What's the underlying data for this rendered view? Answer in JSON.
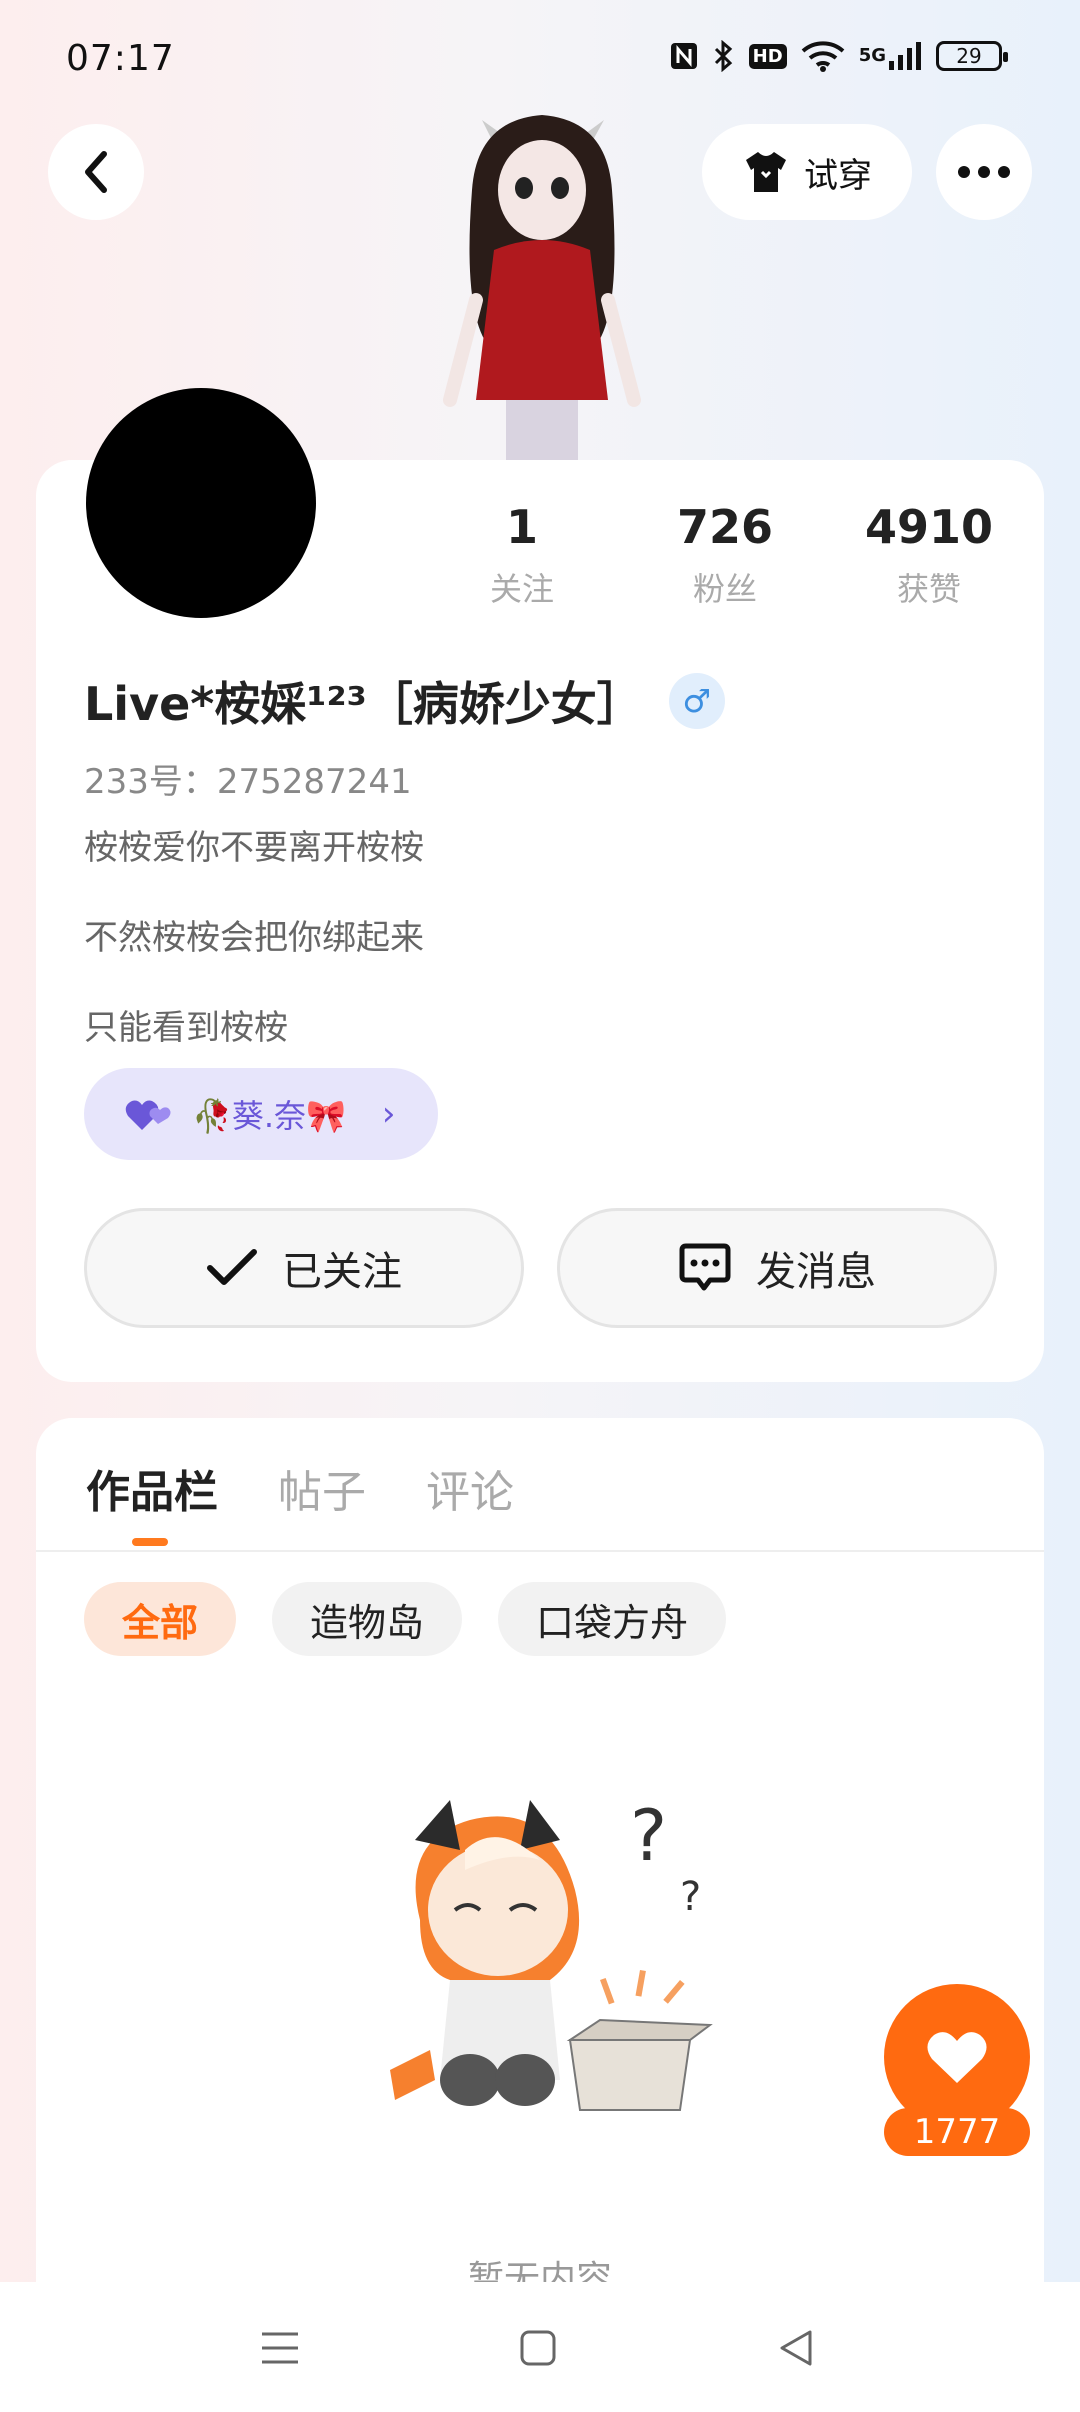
{
  "status_bar": {
    "time": "07:17",
    "icons": [
      "nfc-icon",
      "bluetooth-icon",
      "hd-icon",
      "wifi-icon",
      "5g-signal-icon"
    ],
    "hd_label": "HD",
    "network_label": "5G",
    "battery": "29"
  },
  "header": {
    "tryon_label": "试穿"
  },
  "profile": {
    "stats": [
      {
        "value": "1",
        "label": "关注"
      },
      {
        "value": "726",
        "label": "粉丝"
      },
      {
        "value": "4910",
        "label": "获赞"
      }
    ],
    "nickname": "Live*桉婇¹²³［病娇少女］",
    "gender_symbol": "♂",
    "uid": "233号：275287241",
    "bio": [
      "桉桉爱你不要离开桉桉",
      "不然桉桉会把你绑起来",
      "只能看到桉桉"
    ],
    "tag_label": "🥀葵.奈🎀",
    "follow_label": "已关注",
    "message_label": "发消息"
  },
  "content": {
    "tabs": [
      "作品栏",
      "帖子",
      "评论"
    ],
    "filters": [
      "全部",
      "造物岛",
      "口袋方舟"
    ],
    "empty_text": "暂无内容",
    "like_count": "1777"
  },
  "colors": {
    "accent": "#ff6a10",
    "tag_bg": "#e7e5fb",
    "tag_text": "#6a57d8"
  }
}
